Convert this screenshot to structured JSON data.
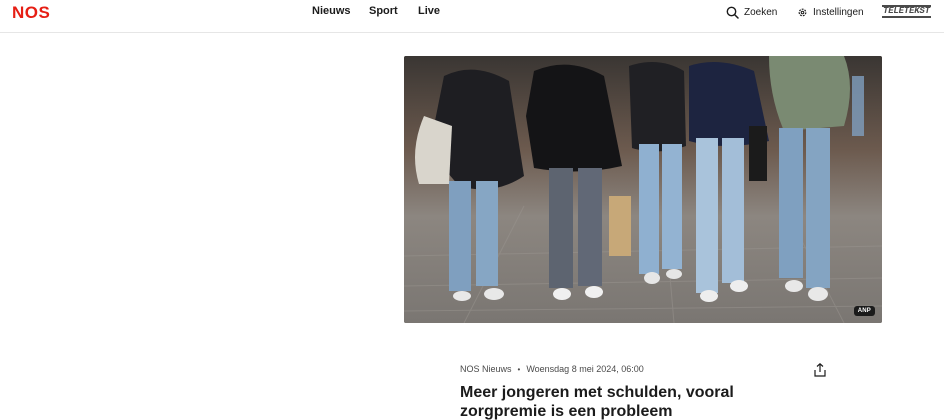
{
  "brand": {
    "logo_text": "NOS",
    "color": "#e61e14"
  },
  "nav": {
    "items": [
      "Nieuws",
      "Sport",
      "Live"
    ]
  },
  "header_actions": {
    "search_label": "Zoeken",
    "settings_label": "Instellingen",
    "teletekst_label": "TELETEKST"
  },
  "hero": {
    "credit": "ANP"
  },
  "article": {
    "source": "NOS Nieuws",
    "date": "Woensdag 8 mei 2024, 06:00",
    "title": "Meer jongeren met schulden, vooral zorgpremie is een probleem"
  },
  "icons": {
    "search": "search-icon",
    "settings": "gear-icon",
    "share": "share-icon"
  }
}
